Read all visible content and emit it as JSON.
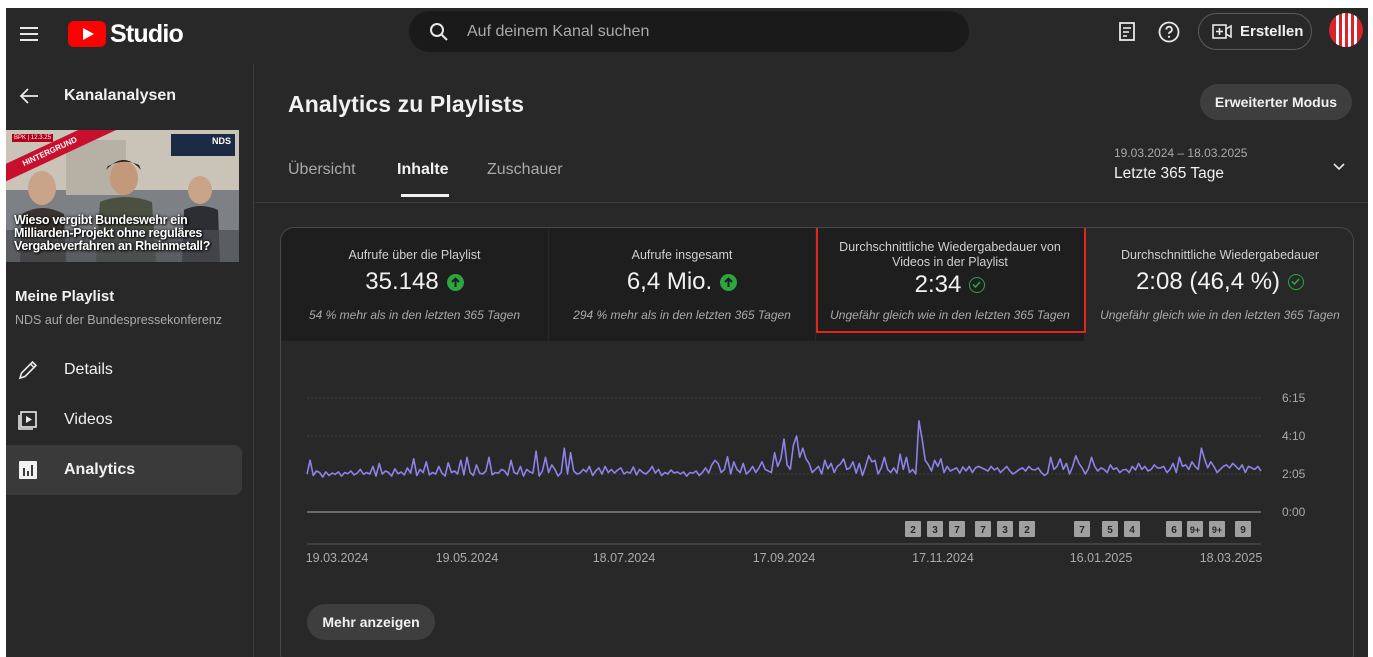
{
  "topbar": {
    "app_name": "Studio",
    "search_placeholder": "Auf deinem Kanal suchen",
    "create_label": "Erstellen"
  },
  "sidebar": {
    "back_label": "Kanalanalysen",
    "thumbnail": {
      "date_label": "BPK | 12.3.25",
      "ribbon": "HINTERGRUND",
      "brand": "NDS",
      "caption": "Wieso vergibt Bundeswehr ein Milliarden-Projekt ohne reguläres Vergabeverfahren an Rheinmetall?"
    },
    "playlist_title": "Meine Playlist",
    "playlist_subtitle": "NDS auf der Bundespressekonferenz",
    "items": [
      {
        "label": "Details",
        "icon": "pencil-icon"
      },
      {
        "label": "Videos",
        "icon": "video-library-icon"
      },
      {
        "label": "Analytics",
        "icon": "analytics-icon",
        "active": true
      }
    ]
  },
  "main": {
    "title": "Analytics zu Playlists",
    "advanced_mode": "Erweiterter Modus",
    "tabs": [
      {
        "label": "Übersicht"
      },
      {
        "label": "Inhalte",
        "active": true
      },
      {
        "label": "Zuschauer"
      }
    ],
    "date_range": {
      "span": "19.03.2024 – 18.03.2025",
      "label": "Letzte 365 Tage"
    },
    "metrics": [
      {
        "label": "Aufrufe über die Playlist",
        "value": "35.148",
        "status": "up",
        "comparison": "54 % mehr als in den letzten 365 Tagen"
      },
      {
        "label": "Aufrufe insgesamt",
        "value": "6,4 Mio.",
        "status": "up",
        "comparison": "294 % mehr als in den letzten 365 Tagen"
      },
      {
        "label": "Durchschnittliche Wiedergabedauer von Videos in der Playlist",
        "value": "2:34",
        "status": "neutral",
        "comparison": "Ungefähr gleich wie in den letzten 365 Tagen"
      },
      {
        "label": "Durchschnittliche Wiedergabedauer",
        "value": "2:08 (46,4 %)",
        "status": "neutral",
        "comparison": "Ungefähr gleich wie in den letzten 365 Tagen"
      }
    ],
    "show_more": "Mehr anzeigen"
  },
  "colors": {
    "line": "#8c82e8",
    "up_badge": "#2ba640",
    "highlight": "#e1261c",
    "marker": "#aaaaaa"
  },
  "chart_data": {
    "type": "line",
    "x_labels": [
      "19.03.2024",
      "19.05.2024",
      "18.07.2024",
      "17.09.2024",
      "17.11.2024",
      "16.01.2025",
      "18.03.2025"
    ],
    "y_ticks": [
      "0:00",
      "2:05",
      "4:10",
      "6:15"
    ],
    "ylim_seconds": [
      0,
      375
    ],
    "series": [
      {
        "values_seconds": [
          125,
          170,
          120,
          135,
          130,
          115,
          132,
          120,
          128,
          124,
          132,
          118,
          130,
          126,
          135,
          122,
          128,
          140,
          124,
          130,
          125,
          150,
          118,
          160,
          125,
          135,
          130,
          118,
          142,
          126,
          132,
          122,
          145,
          128,
          175,
          120,
          140,
          130,
          165,
          122,
          130,
          125,
          150,
          128,
          118,
          162,
          130,
          135,
          125,
          170,
          122,
          180,
          130,
          120,
          155,
          128,
          125,
          135,
          180,
          122,
          130,
          128,
          140,
          135,
          120,
          170,
          130,
          125,
          150,
          118,
          140,
          132,
          128,
          200,
          118,
          135,
          180,
          130,
          155,
          140,
          118,
          130,
          210,
          125,
          195,
          135,
          125,
          128,
          140,
          132,
          150,
          120,
          135,
          145,
          125,
          150,
          130,
          140,
          128,
          138,
          145,
          125,
          132,
          128,
          148,
          122,
          140,
          130,
          125,
          135,
          150,
          128,
          140,
          120,
          130,
          125,
          138,
          128,
          132,
          125,
          132,
          118,
          130,
          128,
          135,
          120,
          130,
          145,
          128,
          155,
          170,
          160,
          130,
          140,
          182,
          125,
          165,
          140,
          130,
          160,
          125,
          135,
          150,
          130,
          145,
          165,
          140,
          135,
          130,
          195,
          150,
          175,
          240,
          155,
          140,
          220,
          250,
          180,
          210,
          175,
          160,
          130,
          140,
          150,
          125,
          170,
          142,
          160,
          130,
          150,
          158,
          175,
          140,
          145,
          165,
          128,
          160,
          120,
          150,
          185,
          165,
          170,
          125,
          145,
          180,
          140,
          130,
          145,
          128,
          190,
          140,
          180,
          130,
          140,
          125,
          300,
          240,
          170,
          155,
          135,
          170,
          150,
          175,
          130,
          150,
          135,
          140,
          145,
          128,
          148,
          135,
          150,
          130,
          145,
          150,
          145,
          140,
          135,
          150,
          138,
          145,
          130,
          140,
          150,
          135,
          125,
          132,
          140,
          145,
          135,
          150,
          140,
          138,
          145,
          130,
          120,
          128,
          180,
          140,
          150,
          175,
          140,
          160,
          125,
          150,
          185,
          160,
          145,
          125,
          142,
          180,
          150,
          135,
          145,
          140,
          130,
          155,
          140,
          145,
          130,
          138,
          140,
          130,
          150,
          138,
          160,
          140,
          150,
          135,
          140,
          155,
          145,
          145,
          150,
          130,
          140,
          160,
          130,
          180,
          150,
          155,
          140,
          165,
          150,
          140,
          210,
          175,
          145,
          165,
          150,
          130,
          140,
          150,
          155,
          145,
          160,
          150,
          140,
          155,
          130,
          150,
          145,
          140,
          150,
          135
        ]
      }
    ],
    "markers": [
      "2",
      "3",
      "7",
      "7",
      "3",
      "2",
      "7",
      "5",
      "4",
      "6",
      "9+",
      "9+",
      "9"
    ]
  }
}
